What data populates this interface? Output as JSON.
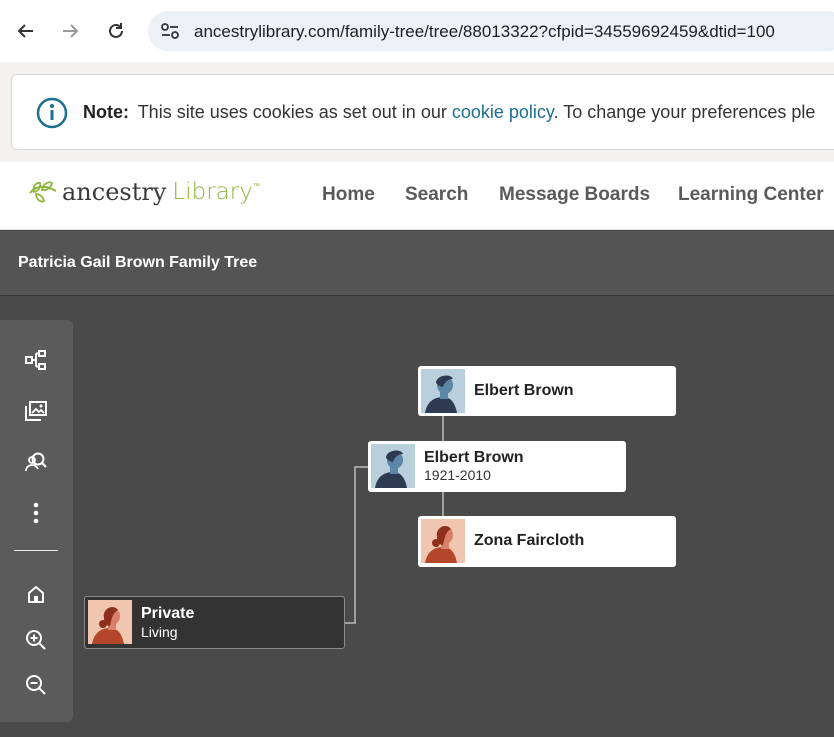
{
  "browser": {
    "url": "ancestrylibrary.com/family-tree/tree/88013322?cfpid=34559692459&dtid=100"
  },
  "cookie_banner": {
    "note_label": "Note:",
    "text_before": "This site uses cookies as set out in our ",
    "link_text": "cookie policy",
    "text_after": ". To change your preferences ple"
  },
  "site_header": {
    "logo_word": "ancestry",
    "logo_library": "Library",
    "logo_tm": "™",
    "nav": [
      "Home",
      "Search",
      "Message Boards",
      "Learning Center"
    ]
  },
  "tree": {
    "title": "Patricia Gail Brown Family Tree",
    "people": {
      "root": {
        "name": "Private",
        "dates": "Living",
        "gender": "female"
      },
      "father": {
        "name": "Elbert Brown",
        "dates": "1921-2010",
        "gender": "male"
      },
      "paternal_grandfather": {
        "name": "Elbert Brown",
        "dates": "",
        "gender": "male"
      },
      "paternal_grandmother": {
        "name": "Zona Faircloth",
        "dates": "",
        "gender": "female"
      }
    }
  },
  "toolbar": {
    "tools": [
      "tree-view-icon",
      "media-gallery-icon",
      "find-person-icon",
      "more-options-icon",
      "home-icon",
      "zoom-in-icon",
      "zoom-out-icon"
    ]
  },
  "colors": {
    "accent_green": "#8cb53c",
    "link_teal": "#1b6f8f",
    "canvas_bg": "#4a4a4a",
    "male_avatar_bg": "#b9cfdb",
    "female_avatar_bg": "#f1c6b0"
  }
}
